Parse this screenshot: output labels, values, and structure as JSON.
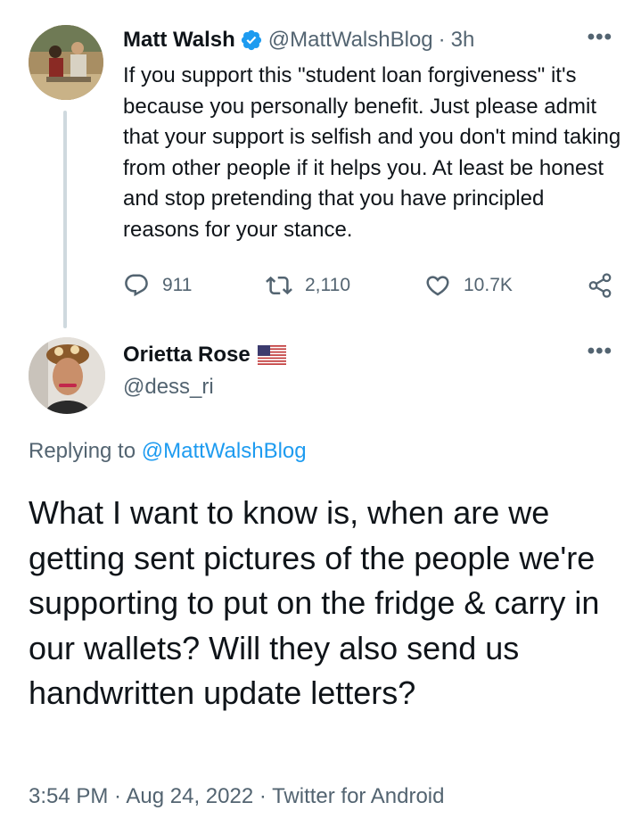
{
  "original_tweet": {
    "author_name": "Matt Walsh",
    "handle": "@MattWalshBlog",
    "separator": "·",
    "time_ago": "3h",
    "more": "•••",
    "text": "If you support this \"student loan forgiveness\" it's because you personally benefit. Just please admit that your support is selfish and you don't mind taking from other people if it helps you. At least be honest and stop pretending that you have principled reasons for your stance.",
    "counts": {
      "replies": "911",
      "retweets": "2,110",
      "likes": "10.7K"
    },
    "verified": true
  },
  "reply_tweet": {
    "author_name": "Orietta Rose",
    "handle": "@dess_ri",
    "more": "•••",
    "replying_prefix": "Replying to",
    "replying_to": "@MattWalshBlog",
    "text": "What I want to know is, when are we getting sent pictures of the people we're supporting to put on the fridge & carry in our wallets? Will they also send us handwritten update letters?",
    "footer": "3:54 PM · Aug 24, 2022 · Twitter for Android"
  },
  "icons": {
    "verified": "verified-badge-icon",
    "flag": "us-flag-icon",
    "reply": "reply-icon",
    "retweet": "retweet-icon",
    "like": "heart-icon",
    "share": "share-icon"
  },
  "colors": {
    "accent": "#1d9bf0",
    "secondary_text": "#536471",
    "primary_text": "#0f1419",
    "thread_line": "#cfd9de"
  }
}
